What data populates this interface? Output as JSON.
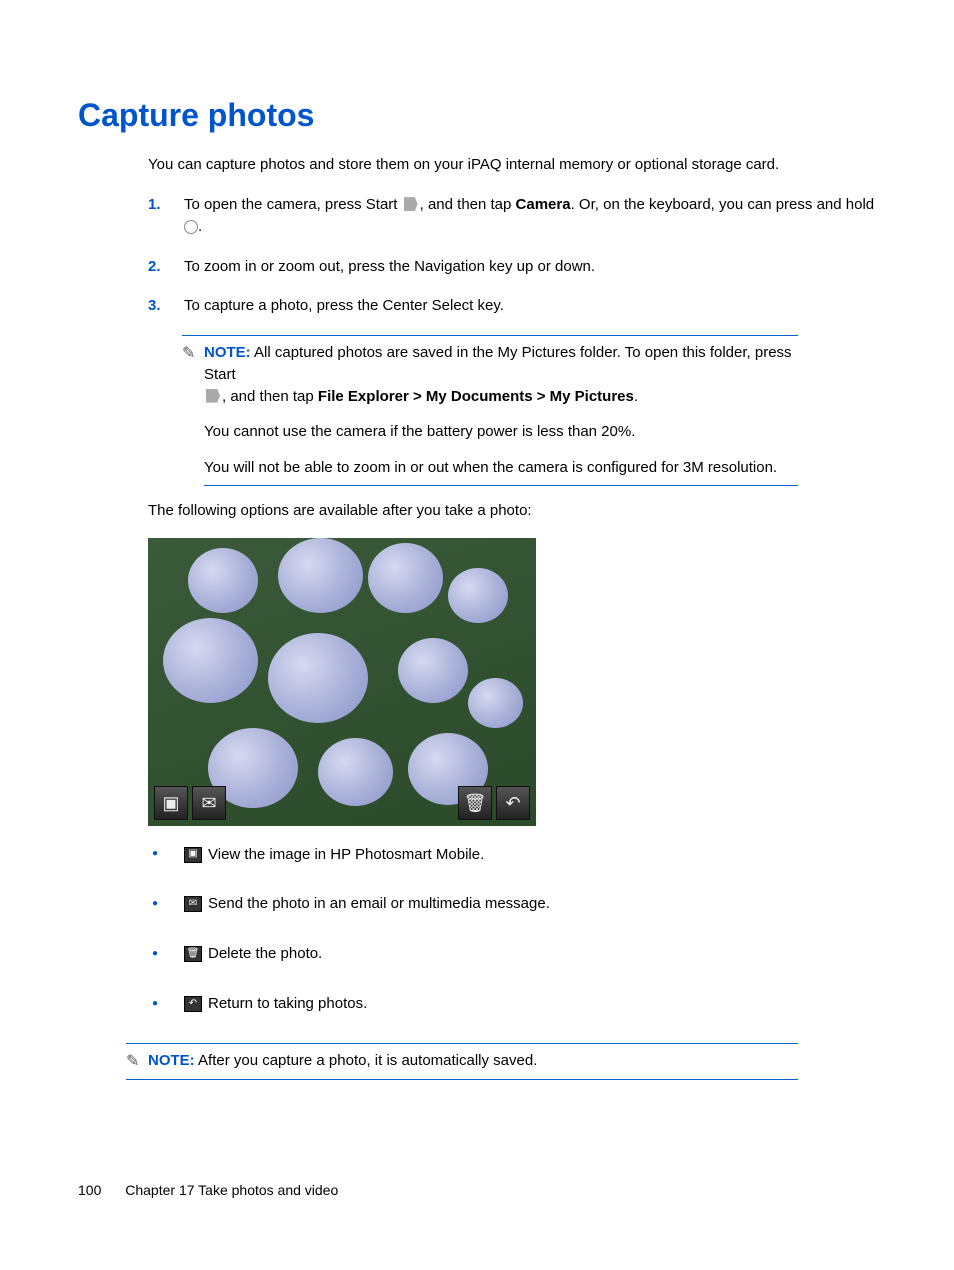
{
  "title": "Capture photos",
  "intro": "You can capture photos and store them on your iPAQ internal memory or optional storage card.",
  "steps": [
    {
      "num": "1.",
      "pre": "To open the camera, press Start ",
      "mid": ", and then tap ",
      "bold": "Camera",
      "post": ". Or, on the keyboard, you can press and hold ",
      "tail": "."
    },
    {
      "num": "2.",
      "text": "To zoom in or zoom out, press the Navigation key up or down."
    },
    {
      "num": "3.",
      "text": "To capture a photo, press the Center Select key."
    }
  ],
  "note1": {
    "label": "NOTE:",
    "line1a": "All captured photos are saved in the My Pictures folder. To open this folder, press Start",
    "line1b_pre": ", and then tap ",
    "line1b_bold": "File Explorer > My Documents > My Pictures",
    "line1b_post": ".",
    "line2": "You cannot use the camera if the battery power is less than 20%.",
    "line3": "You will not be able to zoom in or out when the camera is configured for 3M resolution."
  },
  "optionsIntro": "The following options are available after you take a photo:",
  "bullets": [
    {
      "icon": "image",
      "text": "View the image in HP Photosmart Mobile."
    },
    {
      "icon": "envelope",
      "text": "Send the photo in an email or multimedia message."
    },
    {
      "icon": "trash",
      "text": "Delete the photo."
    },
    {
      "icon": "return",
      "text": "Return to taking photos."
    }
  ],
  "note2": {
    "label": "NOTE:",
    "text": "After you capture a photo, it is automatically saved."
  },
  "footer": {
    "page": "100",
    "chapter": "Chapter 17   Take photos and video"
  }
}
